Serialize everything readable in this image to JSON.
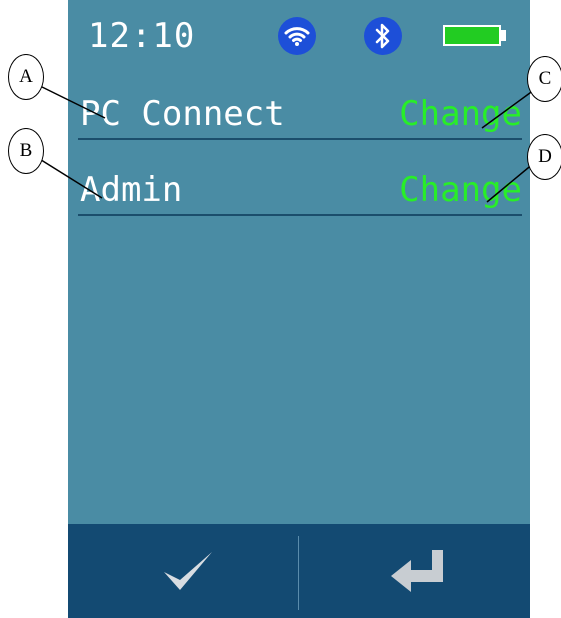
{
  "status_bar": {
    "time": "12:10",
    "wifi_icon": "wifi-icon",
    "bluetooth_icon": "bluetooth-icon",
    "battery_icon": "battery-full-icon",
    "battery_color": "#22cc22"
  },
  "settings": [
    {
      "label": "PC Connect",
      "action": "Change"
    },
    {
      "label": "Admin",
      "action": "Change"
    }
  ],
  "bottom_bar": {
    "confirm_icon": "checkmark-icon",
    "back_icon": "return-arrow-icon"
  },
  "callouts": [
    "A",
    "B",
    "C",
    "D"
  ],
  "colors": {
    "screen_bg": "#4a8ca4",
    "bottom_bar_bg": "#134a72",
    "action_text": "#28ee28",
    "icon_bg": "#1d4fd8"
  }
}
